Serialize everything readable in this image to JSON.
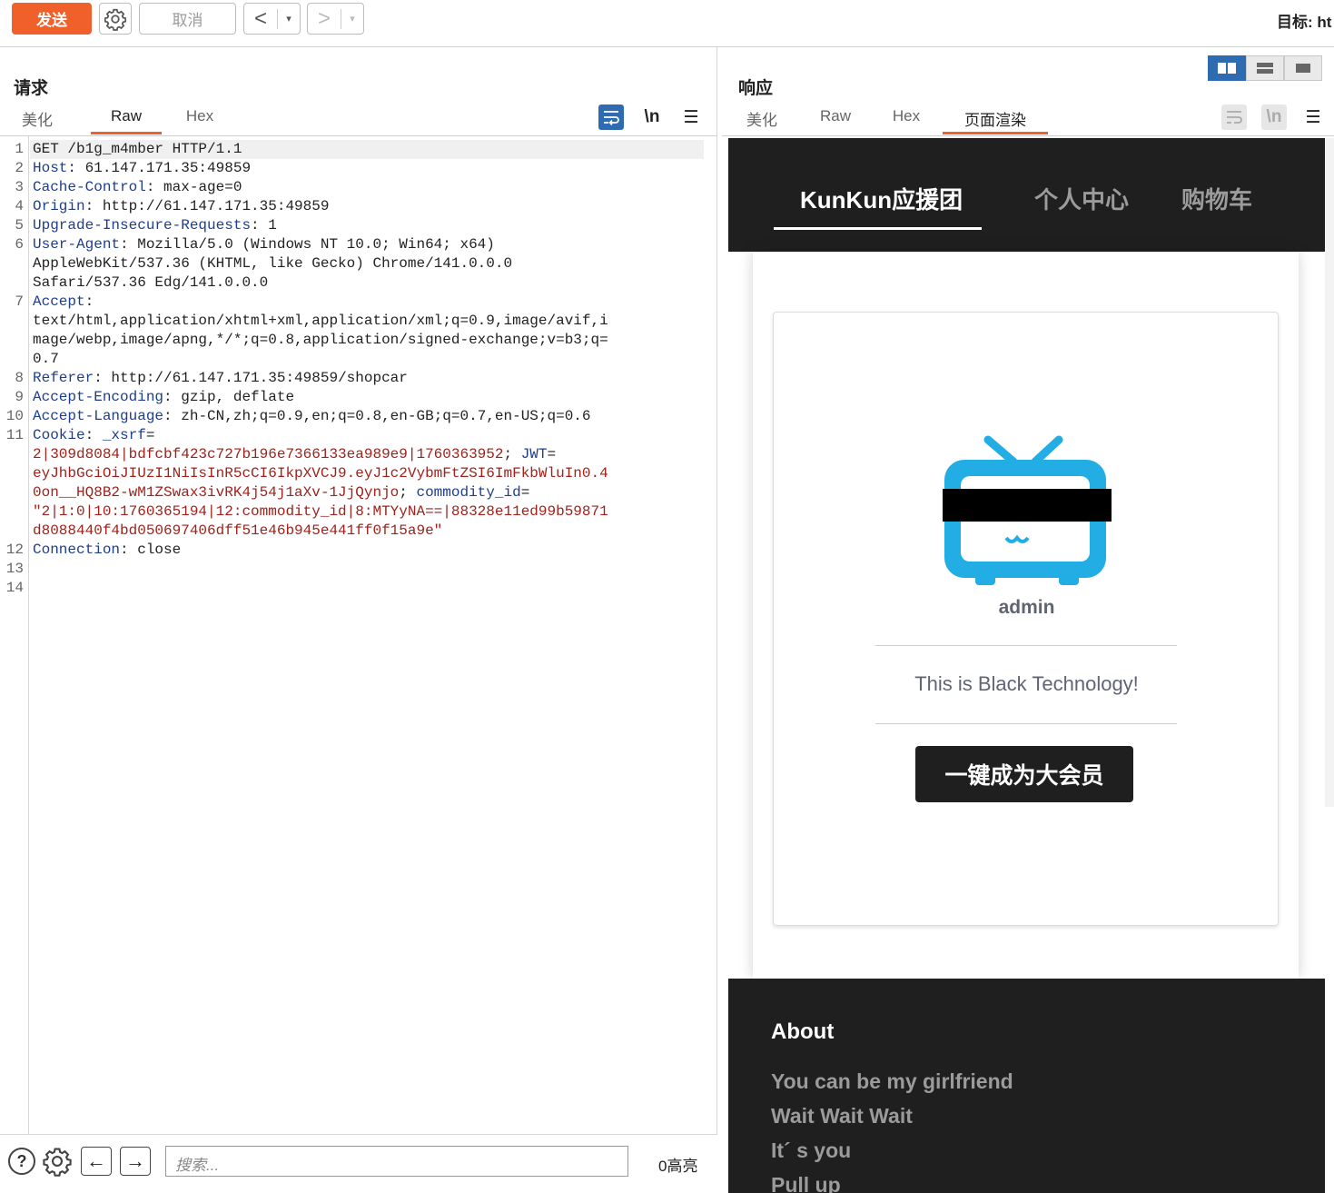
{
  "toolbar": {
    "send_label": "发送",
    "cancel_label": "取消",
    "back_glyph": "<",
    "forward_glyph": ">",
    "dropdown_glyph": "▾",
    "target_label": "目标: ht"
  },
  "request": {
    "title": "请求",
    "tabs": [
      "美化",
      "Raw",
      "Hex"
    ],
    "active_tab": "Raw",
    "newline_label": "\\n",
    "line_numbers": [
      "1",
      "2",
      "3",
      "4",
      "5",
      "6",
      "7",
      "8",
      "9",
      "10",
      "11",
      "12",
      "13",
      "14"
    ],
    "lines": {
      "l1": "GET /b1g_m4mber HTTP/1.1",
      "l2k": "Host",
      "l2v": ": 61.147.171.35:49859",
      "l3k": "Cache-Control",
      "l3v": ": max-age=0",
      "l4k": "Origin",
      "l4v": ": http://61.147.171.35:49859",
      "l5k": "Upgrade-Insecure-Requests",
      "l5v": ": 1",
      "l6k": "User-Agent",
      "l6v": ": Mozilla/5.0 (Windows NT 10.0; Win64; x64)",
      "l6a": "AppleWebKit/537.36 (KHTML, like Gecko) Chrome/141.0.0.0",
      "l6b": "Safari/537.36 Edg/141.0.0.0",
      "l7k": "Accept",
      "l7v": ":",
      "l7a": "text/html,application/xhtml+xml,application/xml;q=0.9,image/avif,i",
      "l7b": "mage/webp,image/apng,*/*;q=0.8,application/signed-exchange;v=b3;q=",
      "l7c": "0.7",
      "l8k": "Referer",
      "l8v": ": http://61.147.171.35:49859/shopcar",
      "l9k": "Accept-Encoding",
      "l9v": ": gzip, deflate",
      "l10k": "Accept-Language",
      "l10v": ": zh-CN,zh;q=0.9,en;q=0.8,en-GB;q=0.7,en-US;q=0.6",
      "l11k": "Cookie",
      "l11v": ": ",
      "c1k": "_xsrf",
      "c1eq": "=",
      "c1v": "2|309d8084|bdfcbf423c727b196e7366133ea989e9|1760363952",
      "c2sep": "; ",
      "c2k": "JWT",
      "c2eq": "=",
      "c2v1": "eyJhbGciOiJIUzI1NiIsInR5cCI6IkpXVCJ9.eyJ1c2VybmFtZSI6ImFkbWluIn0.4",
      "c2v2": "0on__HQ8B2-wM1ZSwax3ivRK4j54j1aXv-1JjQynjo",
      "c3sep": "; ",
      "c3k": "commodity_id",
      "c3eq": "=",
      "c3v1": "\"2|1:0|10:1760365194|12:commodity_id|8:MTYyNA==|88328e11ed99b59871",
      "c3v2": "d8088440f4bd050697406dff51e46b945e441ff0f15a9e\"",
      "l12k": "Connection",
      "l12v": ": close"
    },
    "search_placeholder": "搜索...",
    "highlight_count": "0高亮"
  },
  "response": {
    "title": "响应",
    "tabs": [
      "美化",
      "Raw",
      "Hex",
      "页面渲染"
    ],
    "active_tab": "页面渲染",
    "newline_label": "\\n",
    "rendered": {
      "nav": [
        "KunKun应援团",
        "个人中心",
        "购物车"
      ],
      "nav_active": "KunKun应援团",
      "username": "admin",
      "tagline": "This is Black Technology!",
      "vip_button": "一键成为大会员",
      "footer_title": "About",
      "footer_lines": [
        "You can be my girlfriend",
        "Wait Wait Wait",
        "It´ s you",
        "Pull up"
      ],
      "mascot_color": "#23ade5"
    }
  },
  "colors": {
    "accent": "#f0602a",
    "toggle_active": "#2f6bb0",
    "header_key": "#1d3d8f",
    "cookie_value": "#a0221b",
    "dark_bg": "#1f1f1f"
  }
}
